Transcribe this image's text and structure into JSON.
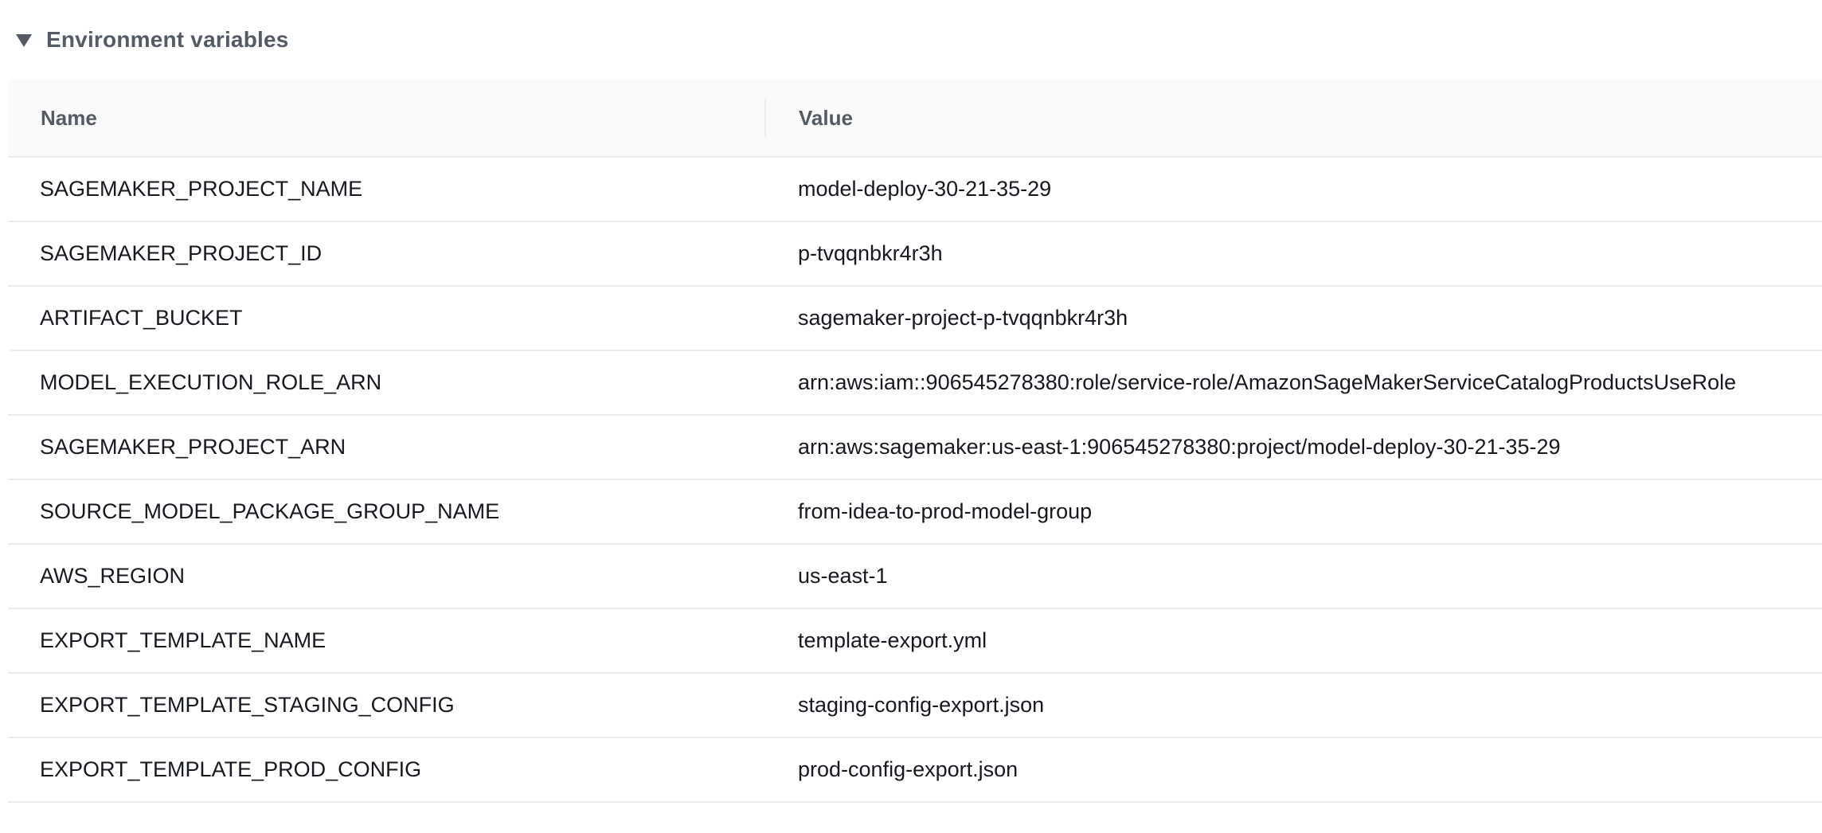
{
  "section": {
    "title": "Environment variables",
    "icon": "caret-down-icon"
  },
  "table": {
    "columns": [
      "Name",
      "Value"
    ],
    "rows": [
      {
        "name": "SAGEMAKER_PROJECT_NAME",
        "value": "model-deploy-30-21-35-29"
      },
      {
        "name": "SAGEMAKER_PROJECT_ID",
        "value": "p-tvqqnbkr4r3h"
      },
      {
        "name": "ARTIFACT_BUCKET",
        "value": "sagemaker-project-p-tvqqnbkr4r3h"
      },
      {
        "name": "MODEL_EXECUTION_ROLE_ARN",
        "value": "arn:aws:iam::906545278380:role/service-role/AmazonSageMakerServiceCatalogProductsUseRole"
      },
      {
        "name": "SAGEMAKER_PROJECT_ARN",
        "value": "arn:aws:sagemaker:us-east-1:906545278380:project/model-deploy-30-21-35-29"
      },
      {
        "name": "SOURCE_MODEL_PACKAGE_GROUP_NAME",
        "value": "from-idea-to-prod-model-group"
      },
      {
        "name": "AWS_REGION",
        "value": "us-east-1"
      },
      {
        "name": "EXPORT_TEMPLATE_NAME",
        "value": "template-export.yml"
      },
      {
        "name": "EXPORT_TEMPLATE_STAGING_CONFIG",
        "value": "staging-config-export.json"
      },
      {
        "name": "EXPORT_TEMPLATE_PROD_CONFIG",
        "value": "prod-config-export.json"
      }
    ]
  }
}
